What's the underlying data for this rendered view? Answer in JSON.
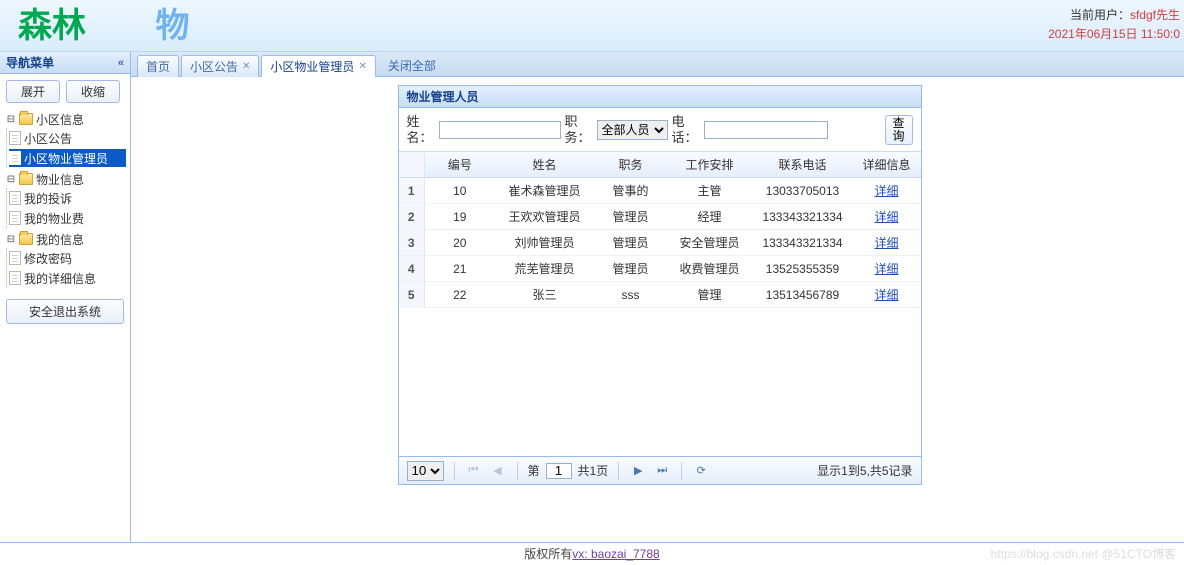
{
  "header": {
    "logo_main": "森林",
    "logo_two": "物",
    "current_user_label": "当前用户：",
    "current_user": "sfdgf先生",
    "timestamp": "2021年06月15日 11:50:0"
  },
  "nav": {
    "title": "导航菜单",
    "btn_expand": "展开",
    "btn_collapse": "收缩",
    "group1": "小区信息",
    "g1_item1": "小区公告",
    "g1_item2": "小区物业管理员",
    "group2": "物业信息",
    "g2_item1": "我的投诉",
    "g2_item2": "我的物业费",
    "group3": "我的信息",
    "g3_item1": "修改密码",
    "g3_item2": "我的详细信息",
    "safe_exit": "安全退出系统"
  },
  "tabs": {
    "t1": "首页",
    "t2": "小区公告",
    "t3": "小区物业管理员",
    "close_all": "关闭全部"
  },
  "panel": {
    "title": "物业管理人员",
    "search": {
      "name_label": "姓名：",
      "job_label": "职务：",
      "job_option": "全部人员",
      "phone_label": "电话：",
      "btn": "查询"
    },
    "columns": {
      "c1": "编号",
      "c2": "姓名",
      "c3": "职务",
      "c4": "工作安排",
      "c5": "联系电话",
      "c6": "详细信息"
    },
    "rows": [
      {
        "n": "1",
        "id": "10",
        "name": "崔术森管理员",
        "job": "管事的",
        "work": "主管",
        "phone": "13033705013",
        "detail": "详细"
      },
      {
        "n": "2",
        "id": "19",
        "name": "王欢欢管理员",
        "job": "管理员",
        "work": "经理",
        "phone": "133343321334",
        "detail": "详细"
      },
      {
        "n": "3",
        "id": "20",
        "name": "刘帅管理员",
        "job": "管理员",
        "work": "安全管理员",
        "phone": "133343321334",
        "detail": "详细"
      },
      {
        "n": "4",
        "id": "21",
        "name": "荒芜管理员",
        "job": "管理员",
        "work": "收费管理员",
        "phone": "13525355359",
        "detail": "详细"
      },
      {
        "n": "5",
        "id": "22",
        "name": "张三",
        "job": "sss",
        "work": "管理",
        "phone": "13513456789",
        "detail": "详细"
      }
    ],
    "pager": {
      "page_size": "10",
      "page_label_prefix": "第",
      "page_value": "1",
      "page_total": "共1页",
      "summary": "显示1到5,共5记录"
    }
  },
  "footer": {
    "text": "版权所有",
    "link": "vx: baozai_7788",
    "watermark": "https://blog.csdn.net @51CTO博客"
  }
}
